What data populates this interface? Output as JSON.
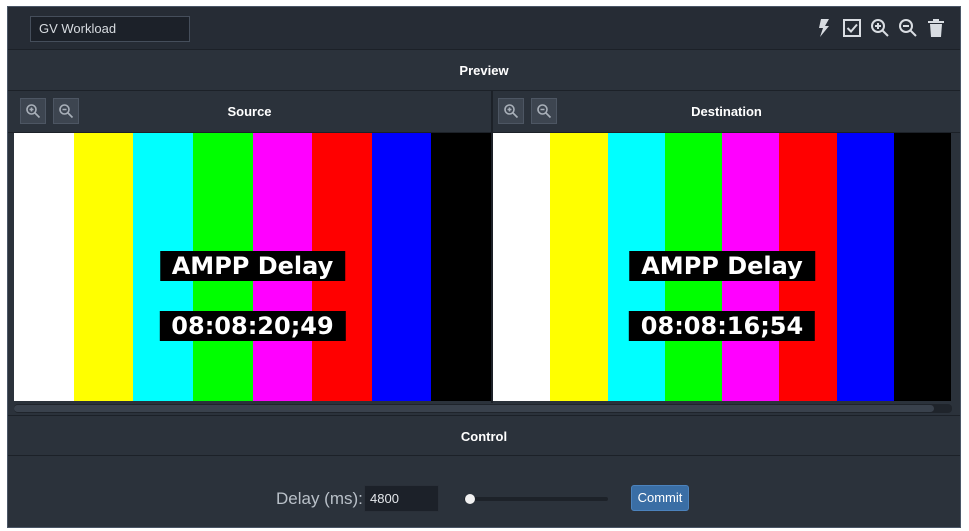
{
  "workload": {
    "title": "GV Workload"
  },
  "toolbar": {
    "icons": [
      "lightning-icon",
      "checkbox-icon",
      "zoom-in-icon",
      "zoom-out-icon",
      "trash-icon"
    ]
  },
  "preview": {
    "heading": "Preview",
    "source": {
      "title": "Source",
      "overlay_title": "AMPP Delay",
      "timecode": "08:08:20;49"
    },
    "destination": {
      "title": "Destination",
      "overlay_title": "AMPP Delay",
      "timecode": "08:08:16;54"
    },
    "color_bars": [
      "#ffffff",
      "#ffff00",
      "#00ffff",
      "#00ff00",
      "#ff00ff",
      "#ff0000",
      "#0000ff",
      "#000000"
    ]
  },
  "control": {
    "heading": "Control",
    "delay_label": "Delay (ms):",
    "delay_value": "4800",
    "commit_label": "Commit",
    "slider_position": 0.04
  },
  "colors": {
    "panel": "#2b323b",
    "accent": "#3a6ea5"
  }
}
